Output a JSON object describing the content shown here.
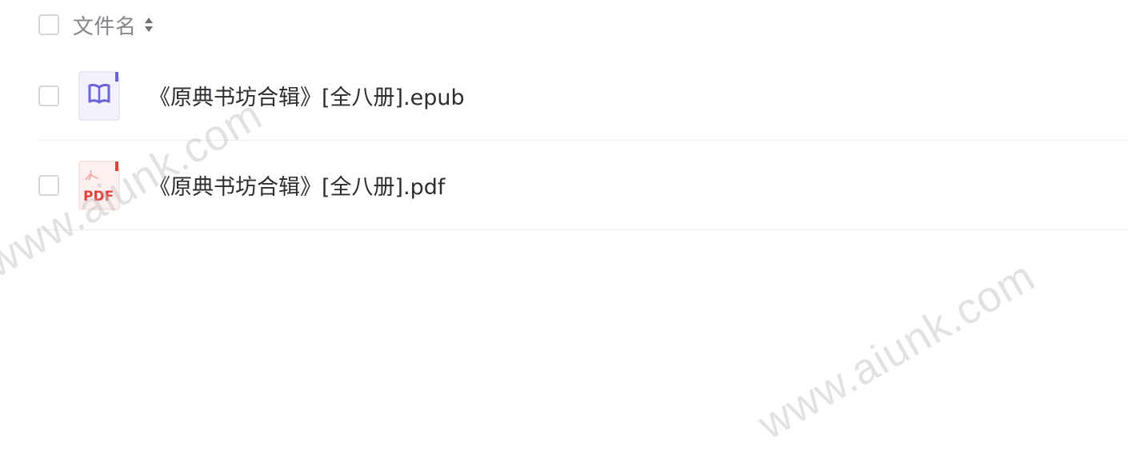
{
  "header": {
    "column_label": "文件名",
    "sort_icon": "sort-updown-icon"
  },
  "files": [
    {
      "name": "《原典书坊合辑》[全八册].epub",
      "icon": "epub-book-icon",
      "icon_color": "#6b63d9"
    },
    {
      "name": "《原典书坊合辑》[全八册].pdf",
      "icon": "pdf-file-icon",
      "icon_label": "PDF",
      "icon_color": "#e2413c"
    }
  ],
  "watermark": {
    "text": "www.aiunk.com"
  }
}
